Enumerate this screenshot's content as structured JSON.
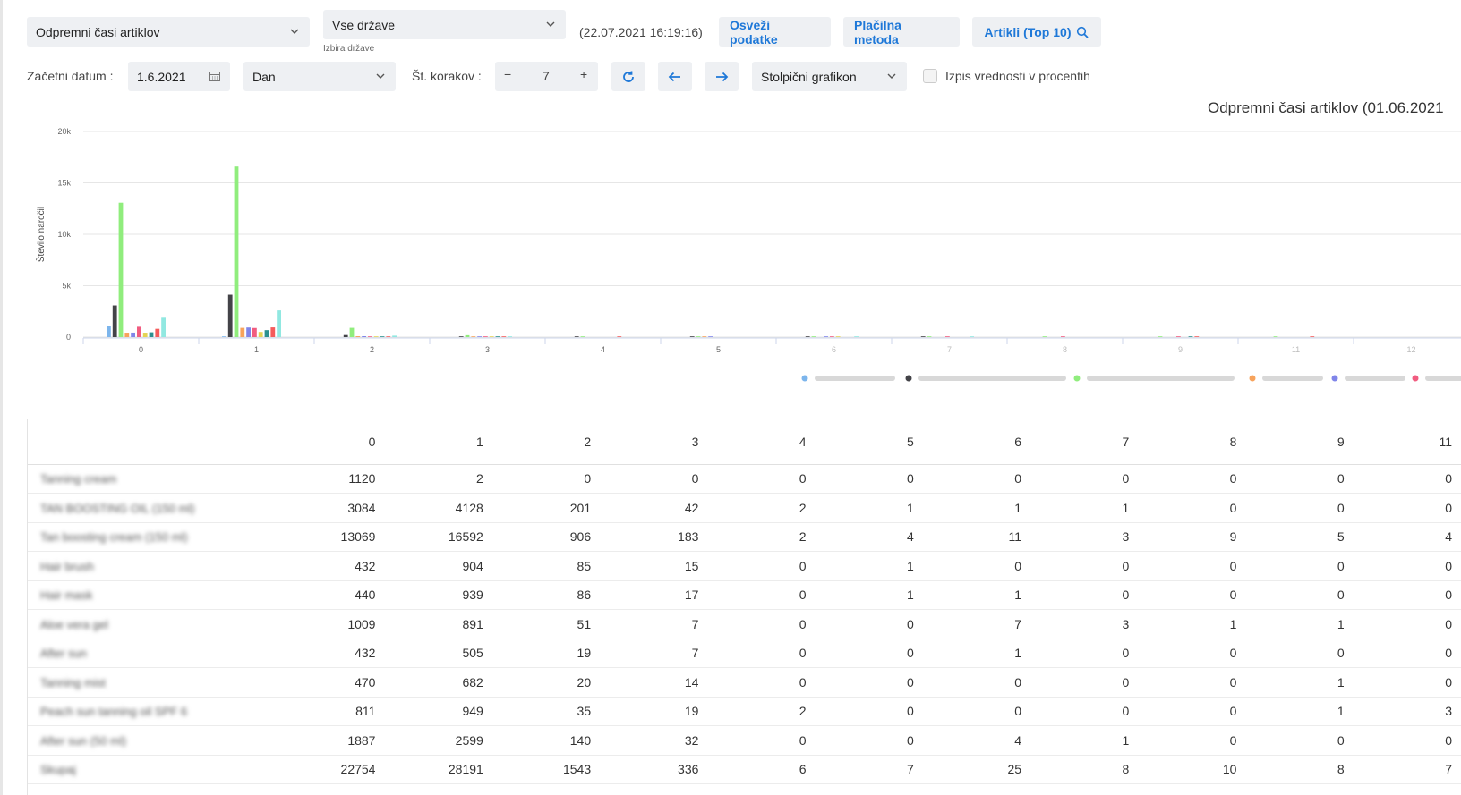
{
  "toolbar": {
    "report_select": "Odpremni časi artiklov",
    "country_select": "Vse države",
    "country_caption": "Izbira države",
    "timestamp": "(22.07.2021 16:19:16)",
    "refresh_button": "Osveži podatke",
    "payment_button": "Plačilna metoda",
    "top_articles_button": "Artikli (Top 10)",
    "start_date_label": "Začetni datum :",
    "start_date_value": "1.6.2021",
    "period_select": "Dan",
    "steps_label": "Št. korakov :",
    "steps_value": "7",
    "chart_type_select": "Stolpični grafikon",
    "percent_checkbox_label": "Izpis vrednosti v procentih",
    "icons": [
      "chevron-down-icon",
      "calendar-icon",
      "minus-icon",
      "plus-icon",
      "refresh-icon",
      "arrow-left-icon",
      "arrow-right-icon",
      "search-icon"
    ]
  },
  "chart_data": {
    "type": "bar",
    "title": "Odpremni časi artiklov (01.06.2021",
    "ylabel": "Število naročil",
    "xlabel": "",
    "ylim": [
      0,
      20000
    ],
    "yticks": [
      "0",
      "5k",
      "10k",
      "15k",
      "20k"
    ],
    "categories": [
      "0",
      "1",
      "2",
      "3",
      "4",
      "5",
      "6",
      "7",
      "8",
      "9",
      "11",
      "12"
    ],
    "colors": [
      "#7cb5ec",
      "#434348",
      "#90ed7d",
      "#f7a35c",
      "#8085e9",
      "#f15c80",
      "#e4d354",
      "#2b908f",
      "#f45b5b",
      "#91e8e1"
    ],
    "series": [
      {
        "values": [
          1120,
          2,
          0,
          0,
          0,
          0,
          0,
          0,
          0,
          0,
          0,
          0
        ]
      },
      {
        "values": [
          3084,
          4128,
          201,
          42,
          2,
          1,
          1,
          1,
          0,
          0,
          0,
          0
        ]
      },
      {
        "values": [
          13069,
          16592,
          906,
          183,
          2,
          4,
          11,
          3,
          9,
          5,
          4,
          0
        ]
      },
      {
        "values": [
          432,
          904,
          85,
          15,
          0,
          1,
          0,
          0,
          0,
          0,
          0,
          0
        ]
      },
      {
        "values": [
          440,
          939,
          86,
          17,
          0,
          1,
          1,
          0,
          0,
          0,
          0,
          0
        ]
      },
      {
        "values": [
          1009,
          891,
          51,
          7,
          0,
          0,
          7,
          3,
          1,
          1,
          0,
          0
        ]
      },
      {
        "values": [
          432,
          505,
          19,
          7,
          0,
          0,
          1,
          0,
          0,
          0,
          0,
          0
        ]
      },
      {
        "values": [
          470,
          682,
          20,
          14,
          0,
          0,
          0,
          0,
          0,
          1,
          0,
          0
        ]
      },
      {
        "values": [
          811,
          949,
          35,
          19,
          2,
          0,
          0,
          0,
          0,
          1,
          3,
          0
        ]
      },
      {
        "values": [
          1887,
          2599,
          140,
          32,
          0,
          0,
          4,
          1,
          0,
          0,
          0,
          0
        ]
      }
    ]
  },
  "table": {
    "columns": [
      "0",
      "1",
      "2",
      "3",
      "4",
      "5",
      "6",
      "7",
      "8",
      "9",
      "11"
    ],
    "rows": [
      {
        "label": "Tanning cream",
        "values": [
          "1120",
          "2",
          "0",
          "0",
          "0",
          "0",
          "0",
          "0",
          "0",
          "0",
          "0"
        ]
      },
      {
        "label": "TAN BOOSTING OIL (150 ml)",
        "values": [
          "3084",
          "4128",
          "201",
          "42",
          "2",
          "1",
          "1",
          "1",
          "0",
          "0",
          "0"
        ]
      },
      {
        "label": "Tan boosting cream (150 ml)",
        "values": [
          "13069",
          "16592",
          "906",
          "183",
          "2",
          "4",
          "11",
          "3",
          "9",
          "5",
          "4"
        ]
      },
      {
        "label": "Hair brush",
        "values": [
          "432",
          "904",
          "85",
          "15",
          "0",
          "1",
          "0",
          "0",
          "0",
          "0",
          "0"
        ]
      },
      {
        "label": "Hair mask",
        "values": [
          "440",
          "939",
          "86",
          "17",
          "0",
          "1",
          "1",
          "0",
          "0",
          "0",
          "0"
        ]
      },
      {
        "label": "Aloe vera gel",
        "values": [
          "1009",
          "891",
          "51",
          "7",
          "0",
          "0",
          "7",
          "3",
          "1",
          "1",
          "0"
        ]
      },
      {
        "label": "After sun",
        "values": [
          "432",
          "505",
          "19",
          "7",
          "0",
          "0",
          "1",
          "0",
          "0",
          "0",
          "0"
        ]
      },
      {
        "label": "Tanning mist",
        "values": [
          "470",
          "682",
          "20",
          "14",
          "0",
          "0",
          "0",
          "0",
          "0",
          "1",
          "0"
        ]
      },
      {
        "label": "Peach sun tanning oil SPF 6",
        "values": [
          "811",
          "949",
          "35",
          "19",
          "2",
          "0",
          "0",
          "0",
          "0",
          "1",
          "3"
        ]
      },
      {
        "label": "After sun (50 ml)",
        "values": [
          "1887",
          "2599",
          "140",
          "32",
          "0",
          "0",
          "4",
          "1",
          "0",
          "0",
          "0"
        ]
      },
      {
        "label": "Skupaj",
        "values": [
          "22754",
          "28191",
          "1543",
          "336",
          "6",
          "7",
          "25",
          "8",
          "10",
          "8",
          "7"
        ]
      }
    ]
  }
}
